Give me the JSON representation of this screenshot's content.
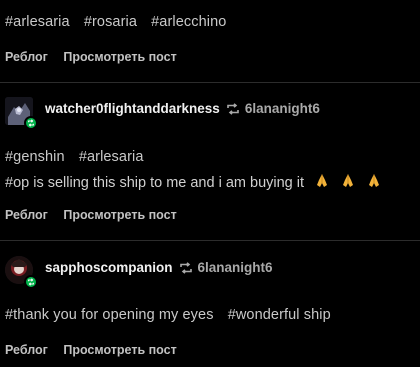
{
  "post1": {
    "tags": [
      "#arlesaria",
      "#rosaria",
      "#arlecchino"
    ],
    "actions": {
      "reblog": "Реблог",
      "view": "Просмотреть пост"
    }
  },
  "post2": {
    "username": "watcher0flightanddarkness",
    "reblogged_from": "6lananight6",
    "tags": [
      "#genshin",
      "#arlesaria"
    ],
    "text": "#op is selling this ship to me and i am buying it",
    "emoji_icon": "folded-hands-emoji",
    "actions": {
      "reblog": "Реблог",
      "view": "Просмотреть пост"
    }
  },
  "post3": {
    "username": "sapphoscompanion",
    "reblogged_from": "6lananight6",
    "tags": [
      "#thank you for opening my eyes",
      "#wonderful ship"
    ],
    "actions": {
      "reblog": "Реблог",
      "view": "Просмотреть пост"
    }
  },
  "colors": {
    "background": "#000000",
    "reblog_badge": "#00b34a",
    "divider": "#2c2c2c"
  }
}
